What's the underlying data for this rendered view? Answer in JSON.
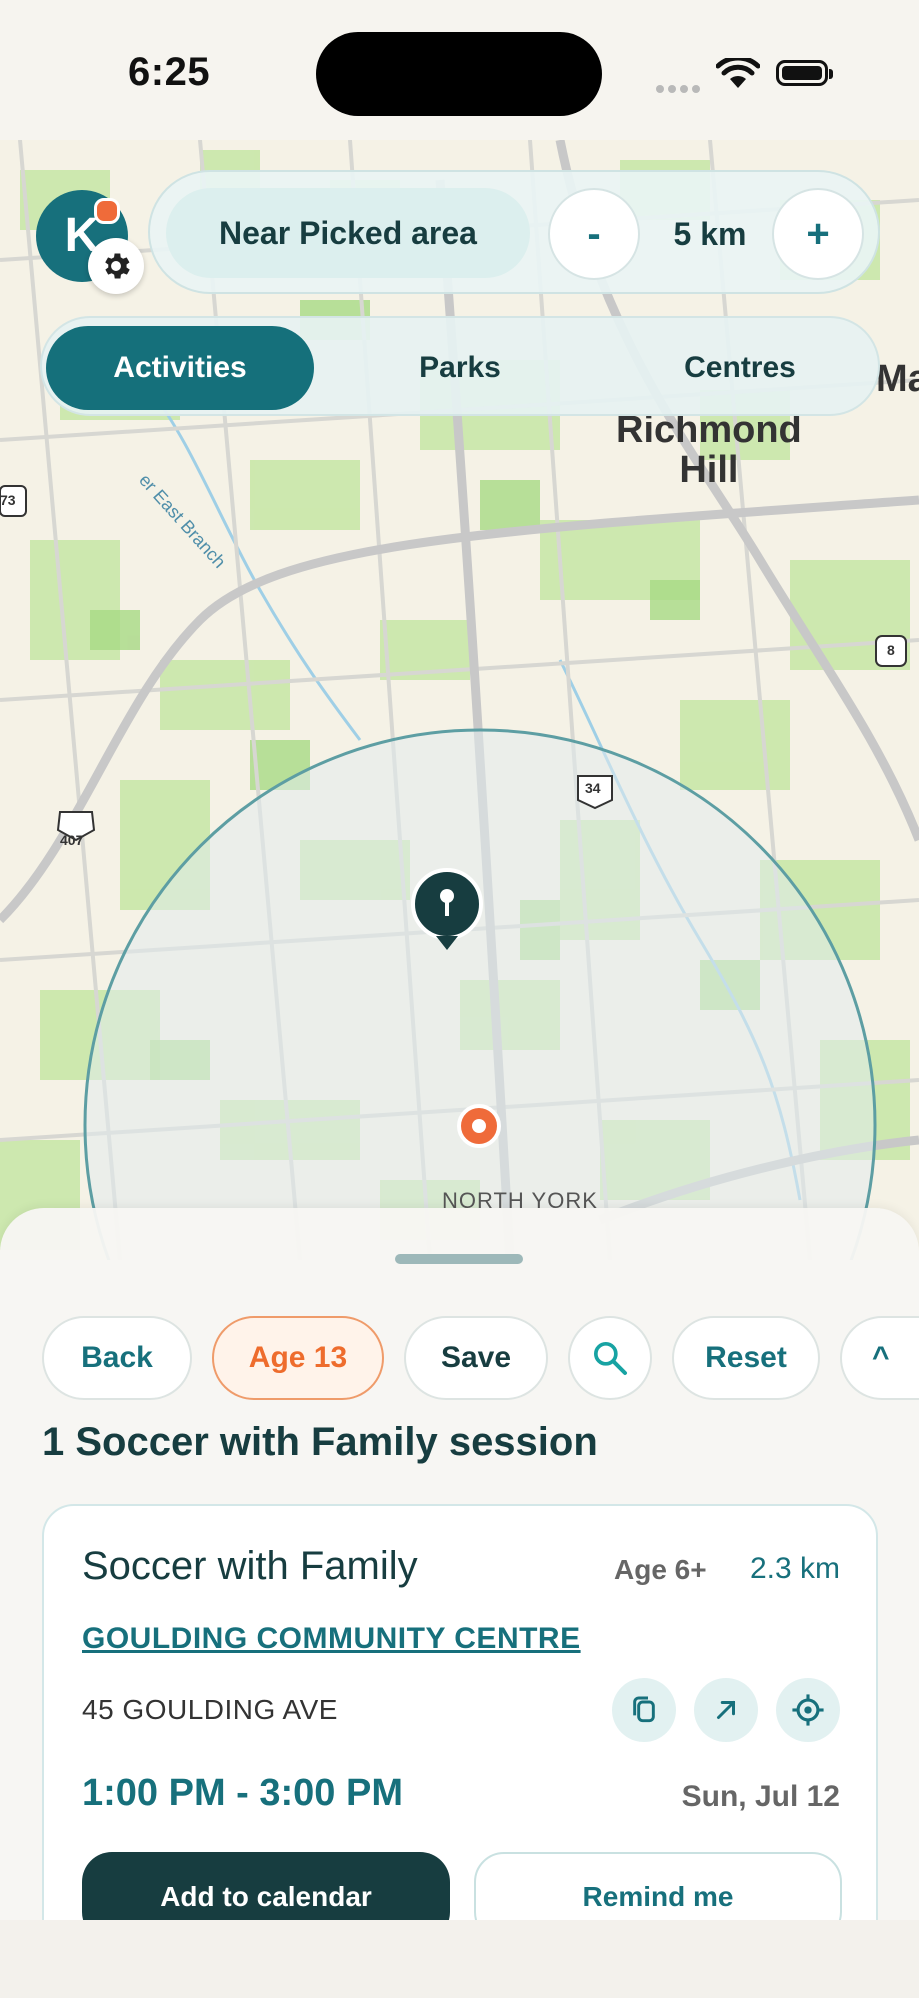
{
  "status_bar": {
    "time": "6:25"
  },
  "map": {
    "labels": {
      "richmond_hill": "Richmond\nHill",
      "east_branch": "er East Branch",
      "north_york": "NORTH YORK",
      "ma": "Ma",
      "hwy_407": "407",
      "hwy_34": "34",
      "hwy_8": "8",
      "hwy_73": "73"
    }
  },
  "header": {
    "logo_letter": "K",
    "location_filter": "Near Picked area",
    "decrease_label": "-",
    "distance": "5 km",
    "increase_label": "+"
  },
  "tabs": [
    {
      "label": "Activities",
      "active": true
    },
    {
      "label": "Parks",
      "active": false
    },
    {
      "label": "Centres",
      "active": false
    }
  ],
  "sheet": {
    "chips": {
      "back": "Back",
      "age": "Age 13",
      "save": "Save",
      "reset": "Reset",
      "collapse": "^"
    },
    "results_title": "1 Soccer with Family session",
    "card": {
      "title": "Soccer with Family",
      "age": "Age 6+",
      "distance": "2.3 km",
      "centre": "GOULDING COMMUNITY CENTRE",
      "address": "45 GOULDING AVE",
      "time": "1:00 PM - 3:00 PM",
      "date": "Sun, Jul 12",
      "add_calendar": "Add to calendar",
      "remind": "Remind me"
    }
  },
  "colors": {
    "brand": "#15707b",
    "accent": "#ee6c2d",
    "dark": "#173d40"
  }
}
